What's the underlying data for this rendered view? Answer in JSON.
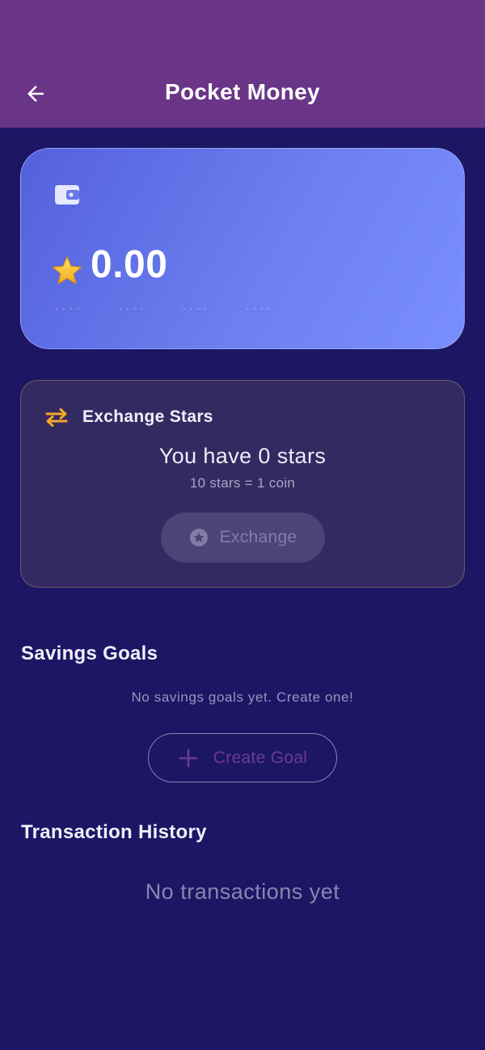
{
  "header": {
    "title": "Pocket Money",
    "back_icon": "arrow-left-icon"
  },
  "wallet": {
    "icon": "wallet-icon",
    "currency_icon": "star-emoji",
    "balance": "0.00",
    "masked_groups": [
      "····",
      "····",
      "····",
      "····"
    ]
  },
  "exchange": {
    "icon": "swap-arrows-icon",
    "title": "Exchange Stars",
    "stars_text": "You have 0 stars",
    "rate_text": "10 stars = 1 coin",
    "button_label": "Exchange",
    "button_icon": "star-circle-icon",
    "button_enabled": false
  },
  "savings": {
    "title": "Savings Goals",
    "empty_text": "No savings goals yet. Create one!",
    "create_button_label": "Create Goal",
    "create_button_icon": "plus-icon"
  },
  "transactions": {
    "title": "Transaction History",
    "empty_text": "No transactions yet"
  },
  "colors": {
    "background": "#1c1665",
    "topbar": "#6a3587",
    "card_gradient_start": "#5460dc",
    "card_gradient_end": "#7a8fff",
    "accent_orange": "#f5a623",
    "create_goal_text": "#6d3b8b"
  }
}
